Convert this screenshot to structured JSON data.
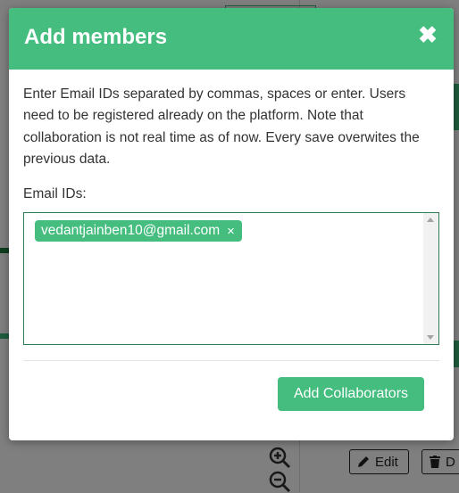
{
  "modal": {
    "title": "Add members",
    "close_icon": "close-icon",
    "description": "Enter Email IDs separated by commas, spaces or enter. Users need to be registered already on the platform. Note that collaboration is not real time as of now. Every save overwites the previous data.",
    "email_label": "Email IDs:",
    "emails": [
      {
        "value": "vedantjainben10@gmail.com",
        "remove": "×"
      }
    ],
    "submit_label": "Add Collaborators",
    "accent_color": "#44bd7f"
  },
  "background": {
    "edit_label": "Edit",
    "delete_label_partial": "D",
    "icons": [
      "zoom-in-icon",
      "zoom-out-icon",
      "pencil-icon",
      "trash-icon"
    ]
  }
}
